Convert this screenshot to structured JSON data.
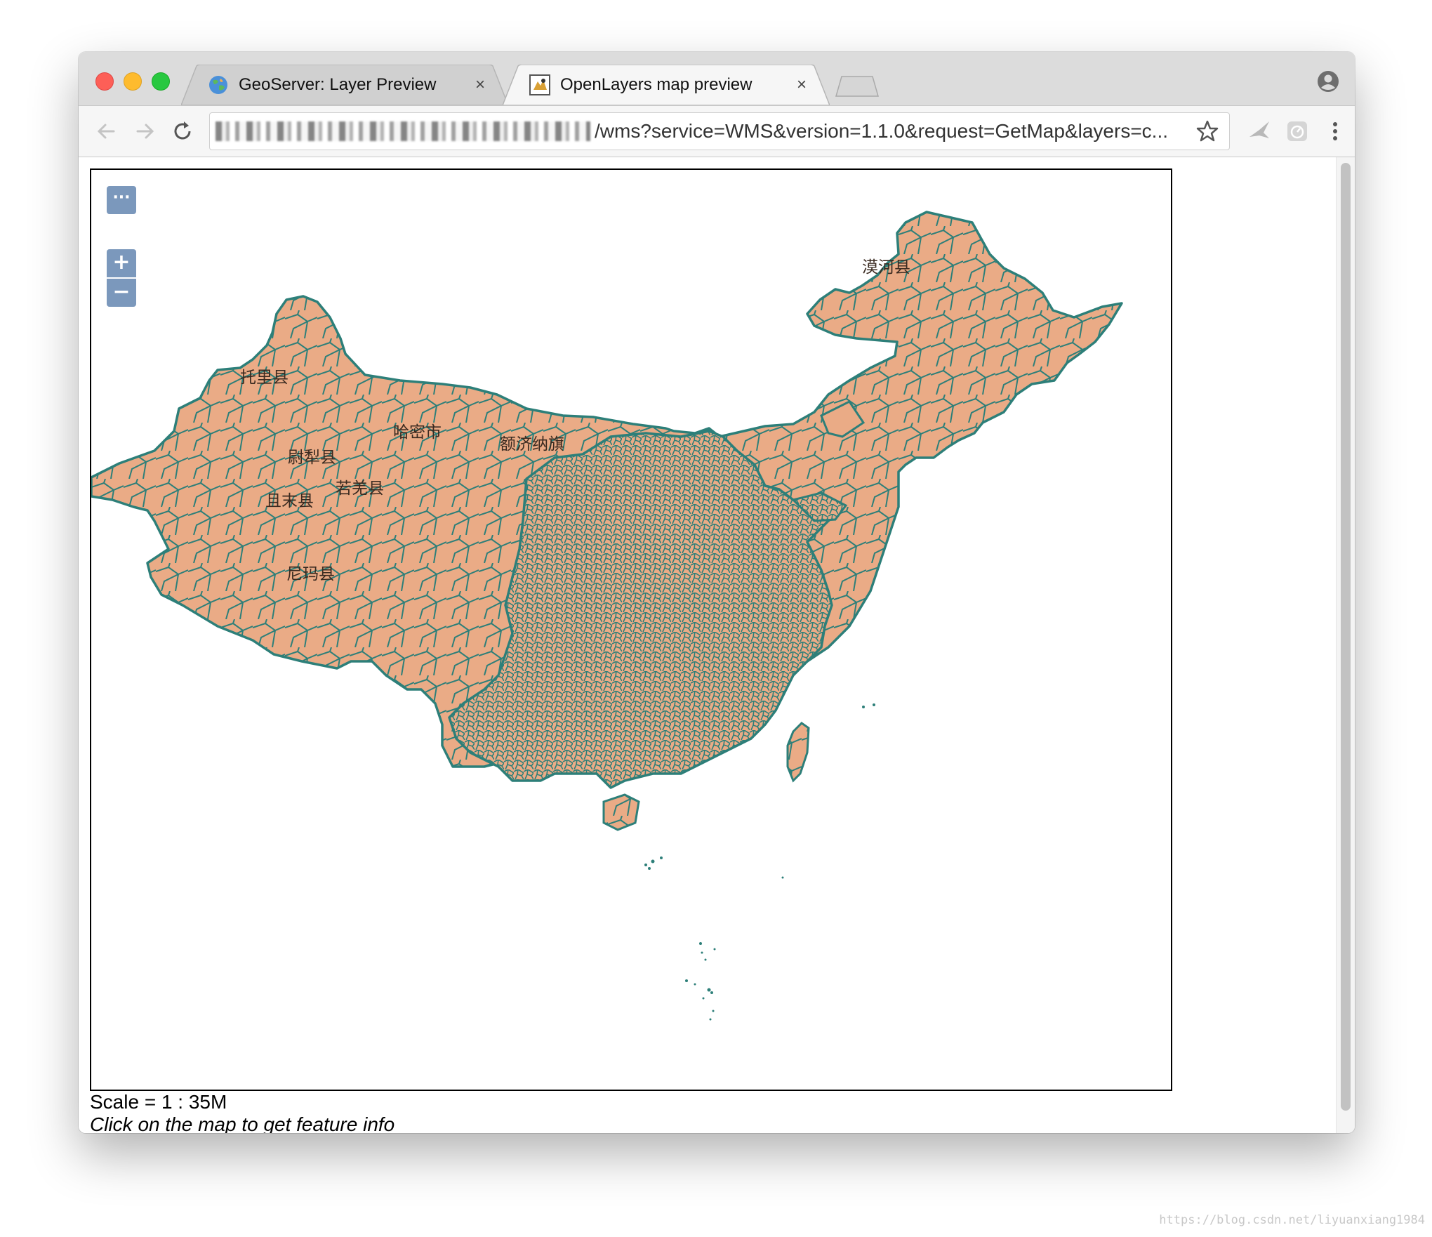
{
  "tabs": [
    {
      "label": "GeoServer: Layer Preview",
      "close": "×",
      "favicon": "geoserver-globe-icon"
    },
    {
      "label": "OpenLayers map preview",
      "close": "×",
      "favicon": "openlayers-icon",
      "active": true
    }
  ],
  "address_bar": {
    "url_visible": "/wms?service=WMS&version=1.1.0&request=GetMap&layers=c..."
  },
  "map": {
    "controls": {
      "options": "···",
      "zoom_in": "+",
      "zoom_out": "−"
    },
    "labels": [
      "漠河县",
      "托里县",
      "哈密市",
      "额济纳旗",
      "尉犁县",
      "若羌县",
      "且末县",
      "尼玛县"
    ],
    "fill_color": "#eaab86",
    "stroke_color": "#2d7f79"
  },
  "status": {
    "scale": "Scale = 1 : 35M",
    "hint": "Click on the map to get feature info"
  },
  "watermark": "https://blog.csdn.net/liyuanxiang1984",
  "colors": {
    "chrome_tabbar": "#dcdcdc",
    "toolbar": "#f6f6f6",
    "ol_button": "#7b98bc"
  }
}
